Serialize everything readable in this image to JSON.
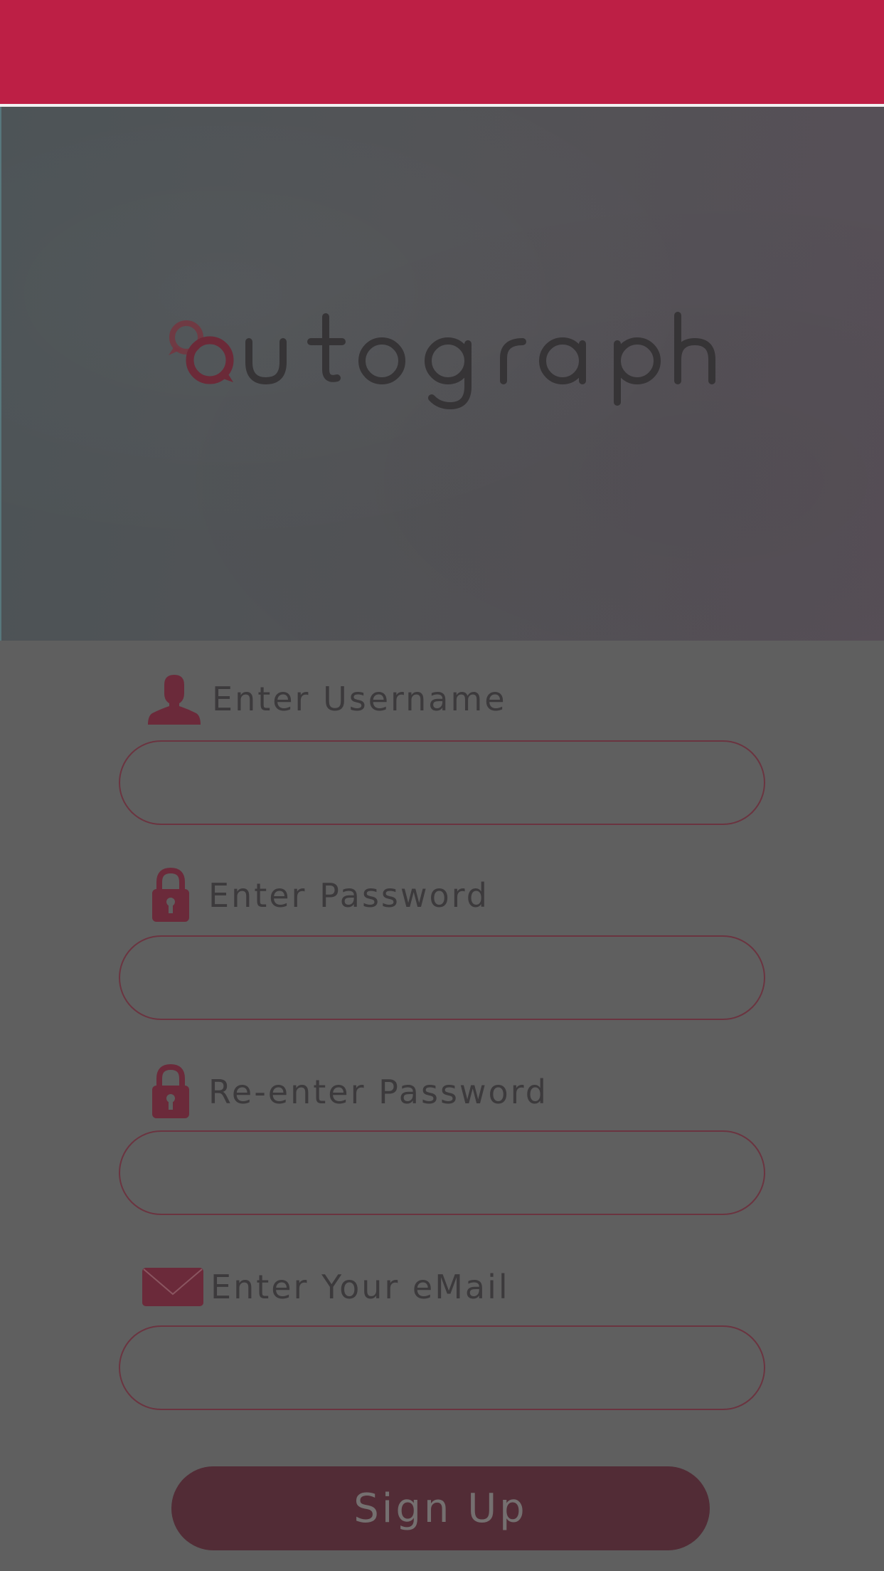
{
  "app": {
    "logo_text": "autograph"
  },
  "colors": {
    "header_accent": "#bd1f45",
    "icon_color": "#6b2a3a",
    "button_bg": "#522c36",
    "background": "#5f5f5f"
  },
  "form": {
    "fields": [
      {
        "label": "Enter Username",
        "icon": "user-icon",
        "value": "",
        "placeholder": ""
      },
      {
        "label": "Enter Password",
        "icon": "lock-icon",
        "value": "",
        "placeholder": ""
      },
      {
        "label": "Re-enter Password",
        "icon": "lock-icon",
        "value": "",
        "placeholder": ""
      },
      {
        "label": "Enter Your eMail",
        "icon": "envelope-icon",
        "value": "",
        "placeholder": ""
      }
    ],
    "submit_label": "Sign Up"
  }
}
